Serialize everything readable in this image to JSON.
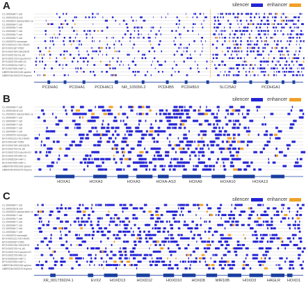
{
  "colors": {
    "silencer": "#2424d6",
    "enhancer": "#f0a128",
    "gene": "#1a3fa0",
    "grid": "#c8c8c8"
  },
  "legend": {
    "silencer_label": "silencer",
    "enhancer_label": "enhancer"
  },
  "tracks_short": [
    "CL:0000084 T cell",
    "CL:0000236 B cell",
    "CL:0000623 natural killer ce",
    "CL:0000084 T cell",
    "CL:0000084 T cell",
    "CL:0000084 T cell",
    "CL:0000084 T cell",
    "CL:0000084 T cell",
    "CL:0000576 monocyte",
    "EFO:0001221 NCI-H929",
    "EFO:0001187 K562",
    "EFO:0002784 GM12878",
    "EFO:0002793 HL-60",
    "EFO:0002715 Kasumi-KO",
    "EFO:0002799 MM.1S",
    "EFO:0005234 HAP-1",
    "EFO:0007590 HAP-1",
    "UBERON:0002106 spleen",
    "UBERON:0002370 thymus"
  ],
  "tracks_long": [
    "CL:0000084 T cell",
    "CL:0000236 B cell",
    "CL:0000623 natural killer ce",
    "CL:0000084 T cell",
    "CL:0000084 T cell",
    "CL:0000084 T cell",
    "CL:0000084 T cell",
    "CL:0000084 T cell",
    "CL:0000084 T cell",
    "CL:0000576 monocyte",
    "EFO:0001221 NCI-H929",
    "EFO:0002067 K562",
    "EFO:0002784 GM12878",
    "EFO:0002793 HL-60",
    "EFO:0002715 Kasumi-KO",
    "EFO:0002799 MM.1S",
    "EFO:0005234 HAP-1",
    "EFO:0007590 HAP-1",
    "UBERON:0002106 spleen",
    "UBERON:0002370 thymus"
  ],
  "panels": [
    {
      "letter": "A",
      "genes": [
        "PCDHA1",
        "PCDHA1",
        "PCDHAC1",
        "NR_105056.2",
        "PCDHB5",
        "PCDHB10",
        "SLC25A2",
        "PCDHGA1"
      ]
    },
    {
      "letter": "B",
      "genes": [
        "HOXA1",
        "HOXA3",
        "HOXA3",
        "HOXA-AS3",
        "HOXA9",
        "HOXA10",
        "HOXA13"
      ]
    },
    {
      "letter": "C",
      "genes": [
        "XR_001739224.1",
        "EVX2",
        "HOXD13",
        "HOXD12",
        "HOXD10",
        "HOXD8",
        "MIR10B",
        "HOXD3",
        "HAGLR",
        "HOXD1"
      ]
    }
  ]
}
